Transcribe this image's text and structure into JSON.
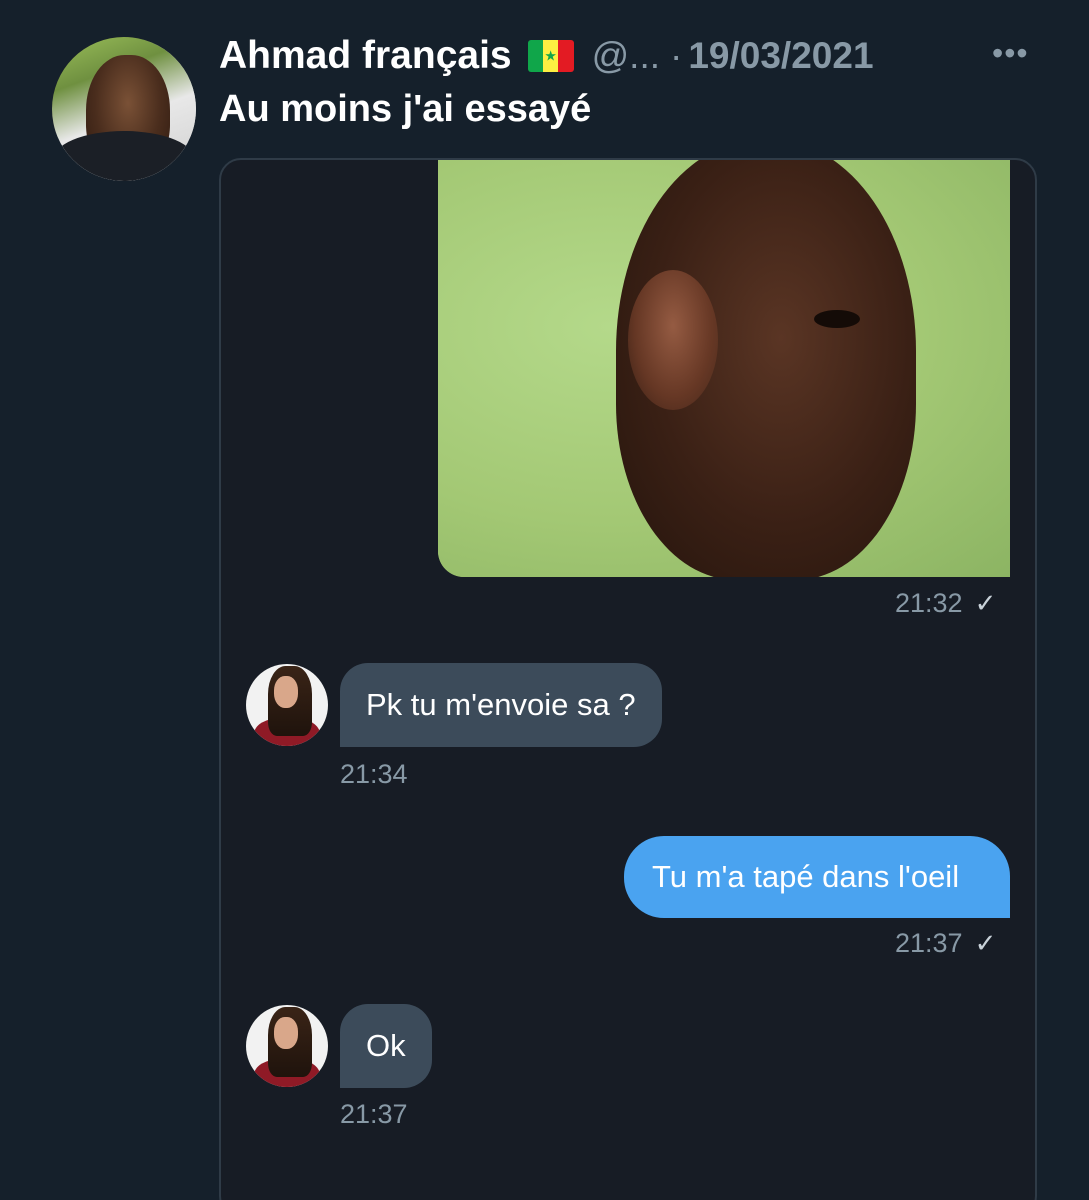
{
  "tweet": {
    "author_name": "Ahmad français",
    "flag_icon": "senegal-flag-icon",
    "handle": "@...",
    "separator": "·",
    "date": "19/03/2021",
    "more_label": "•••",
    "text": "Au moins j'ai essayé"
  },
  "conversation": {
    "messages": [
      {
        "direction": "out",
        "kind": "image",
        "time": "21:32",
        "status": "✓"
      },
      {
        "direction": "in",
        "kind": "text",
        "text": "Pk tu m'envoie sa ?",
        "time": "21:34"
      },
      {
        "direction": "out",
        "kind": "text",
        "text": "Tu m'a tapé dans l'oeil",
        "time": "21:37",
        "status": "✓"
      },
      {
        "direction": "in",
        "kind": "text",
        "text": "Ok",
        "time": "21:37"
      }
    ]
  },
  "colors": {
    "background": "#15202b",
    "incoming_bubble": "#3c4b5a",
    "outgoing_bubble": "#4aa3f0",
    "muted_text": "#8899a6"
  }
}
